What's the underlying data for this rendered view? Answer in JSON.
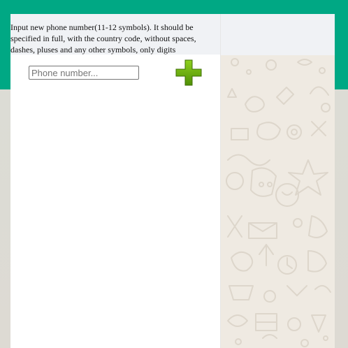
{
  "instruction": {
    "text": "Input new phone number(11-12 symbols). It should be specified in full, with the country code, without spaces, dashes, pluses and any other symbols, only digits"
  },
  "phone_input": {
    "value": "",
    "placeholder": "Phone number..."
  },
  "add_button": {
    "icon": "plus-icon",
    "color": "#5a9e0c"
  },
  "colors": {
    "brand_green": "#00a884",
    "panel_header": "#f0f2f5",
    "chat_background": "#efeae2"
  }
}
